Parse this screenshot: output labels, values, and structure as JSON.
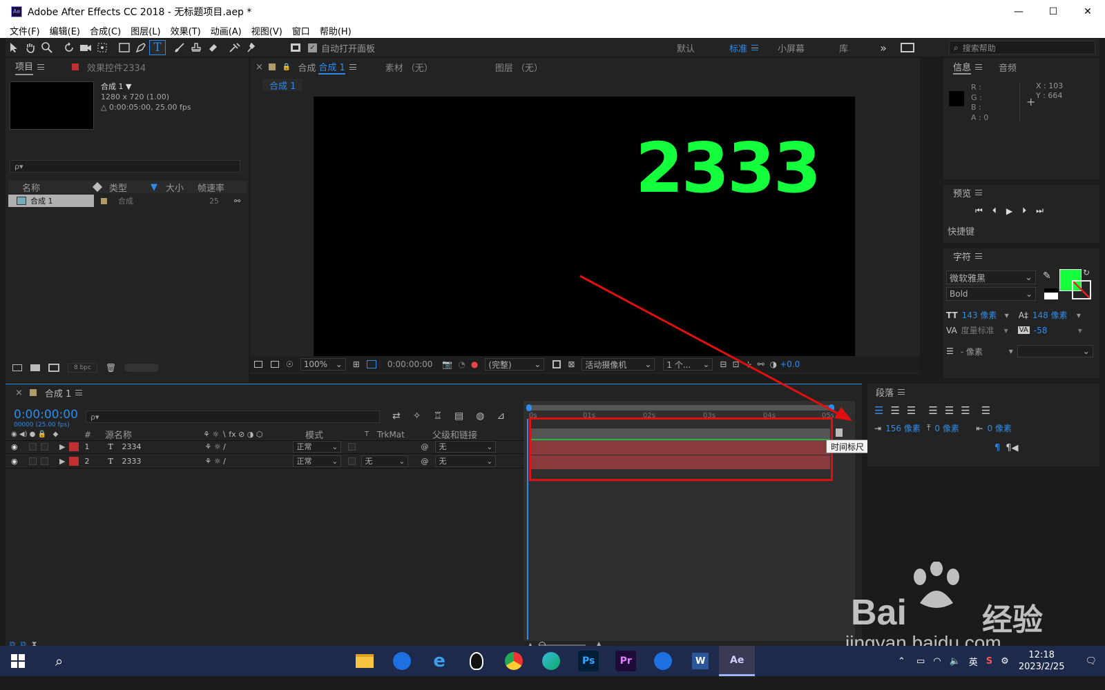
{
  "window": {
    "title": "Adobe After Effects CC 2018 - 无标题项目.aep *",
    "minimize": "—",
    "maximize": "☐",
    "close": "✕"
  },
  "menu": [
    "文件(F)",
    "编辑(E)",
    "合成(C)",
    "图层(L)",
    "效果(T)",
    "动画(A)",
    "视图(V)",
    "窗口",
    "帮助(H)"
  ],
  "toolbar": {
    "auto_open_label": "自动打开面板",
    "workspaces": [
      "默认",
      "标准",
      "小屏幕",
      "库"
    ],
    "active_workspace": "标准",
    "help_placeholder": "搜索帮助",
    "more": "»"
  },
  "project": {
    "tab": "项目",
    "effects_tab": "效果控件2334",
    "comp_name": "合成 1 ▼",
    "comp_size": "1280 x 720 (1.00)",
    "comp_duration": "△ 0:00:05:00, 25.00 fps",
    "search_placeholder": "ρ▾",
    "columns": [
      "名称",
      "类型",
      "大小",
      "帧速率"
    ],
    "item": {
      "name": "合成 1",
      "type": "合成",
      "fps": "25"
    },
    "bpc": "8 bpc"
  },
  "viewer": {
    "tab": "合成",
    "tab_comp": "合成 1",
    "source_tab": "素材 （无）",
    "layer_tab": "图层 （无）",
    "crumb": "合成 1",
    "canvas_text": "2333",
    "canvas_text_color": "#14ff3c",
    "zoom": "100%",
    "timecode": "0:00:00:00",
    "quality": "(完整)",
    "camera": "活动摄像机",
    "views": "1 个...",
    "exposure": "+0.0"
  },
  "info": {
    "tab": "信息",
    "audio_tab": "音频",
    "r": "R :",
    "g": "G :",
    "b": "B :",
    "a": "A : 0",
    "x": "X : 103",
    "y": "Y : 664"
  },
  "preview": {
    "tab": "预览",
    "shortcut": "快捷键"
  },
  "character": {
    "tab": "字符",
    "font": "微软雅黑",
    "style": "Bold",
    "size": "143 像素",
    "leading": "148 像素",
    "kerning": "度量标准",
    "tracking": "-58",
    "indent": "- 像素",
    "fill_color": "#14ff3c"
  },
  "timeline": {
    "tab": "合成 1",
    "timecode": "0:00:00:00",
    "fps": "00000 (25.00 fps)",
    "search_placeholder": "ρ▾",
    "headers": {
      "num": "#",
      "name": "源名称",
      "mode": "模式",
      "t": "T",
      "trkmat": "TrkMat",
      "parent": "父级和链接"
    },
    "ruler": [
      "0s",
      "01s",
      "02s",
      "03s",
      "04s",
      "05s"
    ],
    "layers": [
      {
        "num": "1",
        "name": "2334",
        "mode": "正常",
        "trkmat": "",
        "parent": "无"
      },
      {
        "num": "2",
        "name": "2333",
        "mode": "正常",
        "trkmat": "无",
        "parent": "无"
      }
    ],
    "tooltip": "时间标尺（单击以设置缩览图）"
  },
  "paragraph": {
    "tab": "段落",
    "indent_left": "156 像素",
    "indent_right": "0 像素",
    "indent_first": "0 像素",
    "space": "0 像素"
  },
  "taskbar": {
    "clock": "12:18",
    "date": "2023/2/25",
    "ime": "英",
    "apps": [
      "Ps",
      "Pr",
      "Ae"
    ]
  },
  "watermark": {
    "brand": "Bai",
    "brand2": "经验",
    "url": "jingyan.baidu.com"
  },
  "annotation_color": "#e01010"
}
